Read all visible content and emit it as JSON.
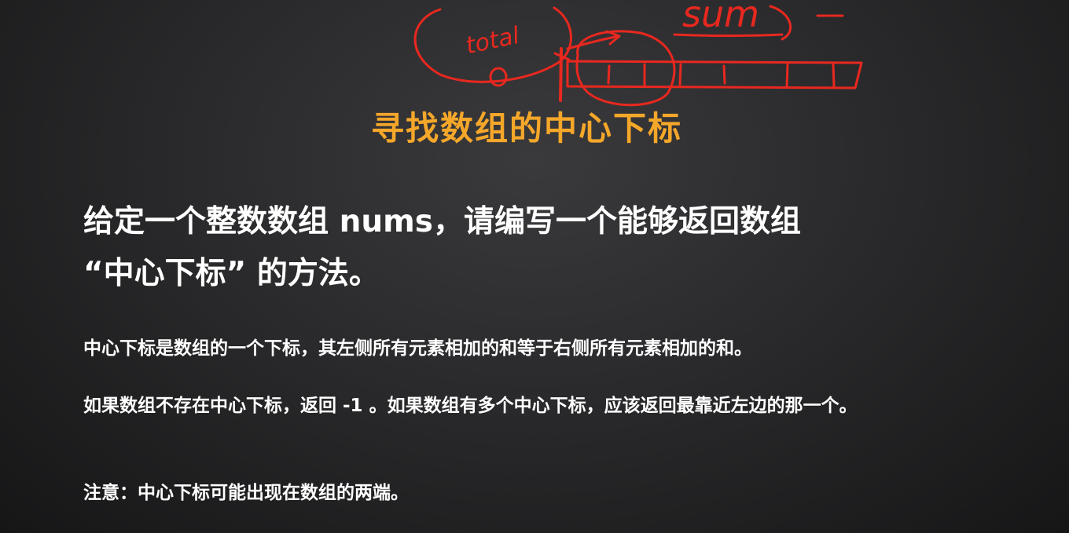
{
  "annotation": {
    "handwriting_left": "total",
    "handwriting_right": "sum",
    "color": "#e8281f"
  },
  "slide": {
    "title": "寻找数组的中心下标",
    "question_line1": "给定一个整数数组 nums，请编写一个能够返回数组",
    "question_line2": "“中心下标” 的方法。",
    "definition": "中心下标是数组的一个下标，其左侧所有元素相加的和等于右侧所有元素相加的和。",
    "rule": "如果数组不存在中心下标，返回 -1 。如果数组有多个中心下标，应该返回最靠近左边的那一个。",
    "note": "注意：中心下标可能出现在数组的两端。",
    "title_color": "#f5a72a",
    "text_color": "#ffffff"
  }
}
